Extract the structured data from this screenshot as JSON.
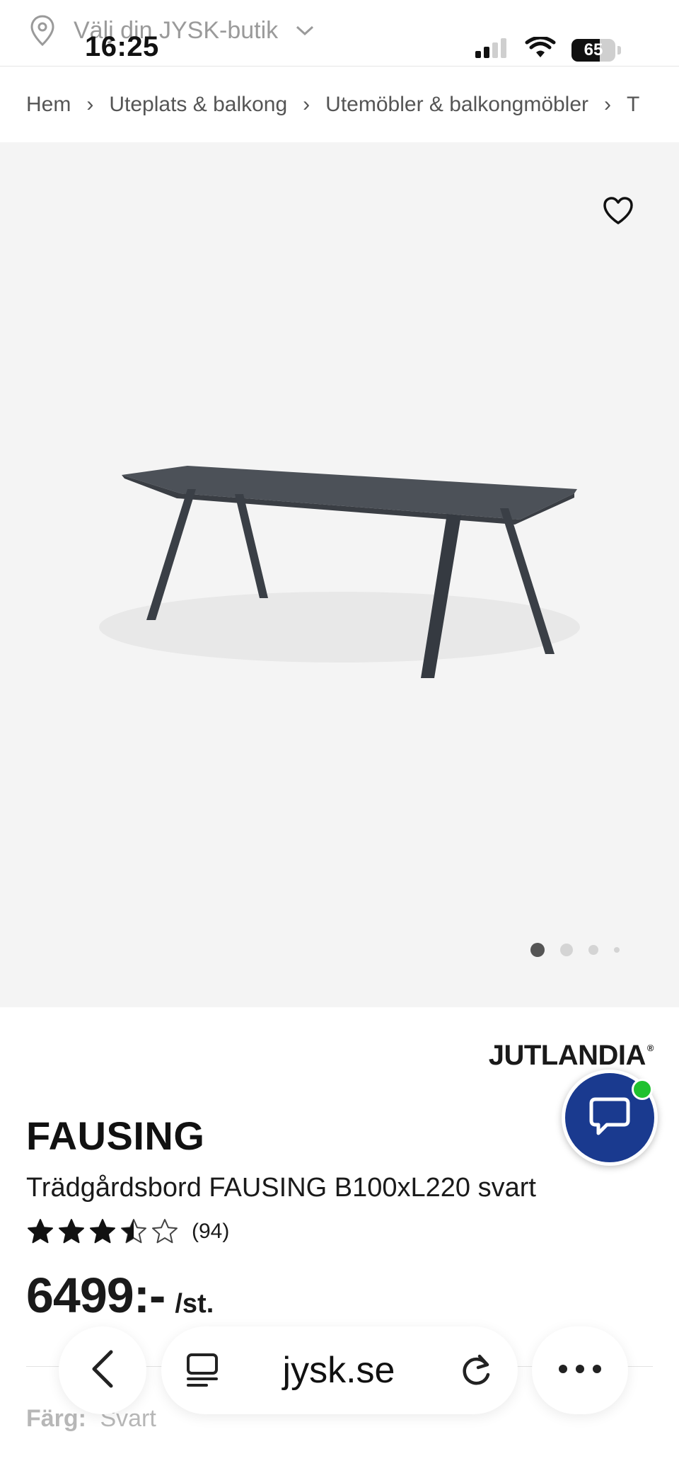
{
  "status_bar": {
    "time": "16:25",
    "battery_level": "65",
    "battery_fraction": 0.65
  },
  "store_picker": {
    "label": "Välj din JYSK-butik"
  },
  "breadcrumb": [
    {
      "label": "Hem"
    },
    {
      "label": "Uteplats & balkong"
    },
    {
      "label": "Utemöbler & balkongmöbler"
    },
    {
      "label": "T"
    }
  ],
  "gallery": {
    "dot_count": 4,
    "active_index": 0
  },
  "product": {
    "brand": "JUTLANDIA",
    "name": "FAUSING",
    "description": "Trädgårdsbord FAUSING B100xL220 svart",
    "rating": 3.5,
    "rating_max": 5,
    "review_count": "(94)",
    "price": "6499:-",
    "price_unit": "/st.",
    "color_label": "Färg:",
    "color_value": "Svart"
  },
  "browser": {
    "url": "jysk.se"
  },
  "colors": {
    "chat_button": "#1a3a8f",
    "chat_online": "#1fc12f",
    "image_bg": "#f4f4f4"
  },
  "icons": {
    "store": "location-pin-icon",
    "store_dropdown": "chevron-down-icon",
    "favorite": "heart-icon",
    "chat": "chat-bubble-icon",
    "back": "chevron-left-icon",
    "tabs": "tabs-icon",
    "reload": "reload-icon",
    "more": "more-icon"
  }
}
